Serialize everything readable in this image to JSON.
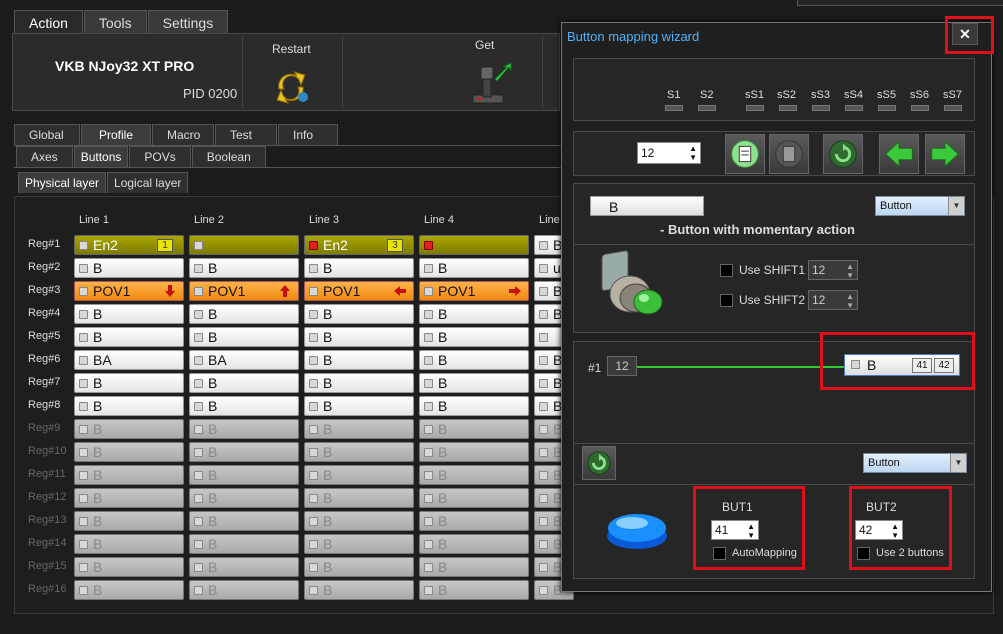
{
  "top_tabs": [
    "Action",
    "Tools",
    "Settings"
  ],
  "device": {
    "name": "VKB NJoy32 XT PRO",
    "pid": "PID 0200"
  },
  "header_buttons": {
    "restart": "Restart",
    "get": "Get"
  },
  "profile_tabs": [
    "Global",
    "Profile",
    "Macro",
    "Test",
    "Info"
  ],
  "sub_tabs": [
    "Axes",
    "Buttons",
    "POVs",
    "Boolean"
  ],
  "layer_tabs": [
    "Physical layer",
    "Logical layer"
  ],
  "columns": [
    "Line 1",
    "Line 2",
    "Line 3",
    "Line 4",
    "Line"
  ],
  "rows": [
    {
      "label": "Reg#1",
      "cells": [
        {
          "text": "En2",
          "num": "1"
        },
        {
          "text": ""
        },
        {
          "text": "En2",
          "num": "3"
        },
        {
          "text": ""
        },
        {
          "text": "B"
        }
      ]
    },
    {
      "label": "Reg#2",
      "cells": [
        {
          "text": "B"
        },
        {
          "text": "B"
        },
        {
          "text": "B"
        },
        {
          "text": "B"
        },
        {
          "text": "u"
        }
      ]
    },
    {
      "label": "Reg#3",
      "cells": [
        {
          "text": "POV1"
        },
        {
          "text": "POV1"
        },
        {
          "text": "POV1"
        },
        {
          "text": "POV1"
        },
        {
          "text": "B"
        }
      ]
    },
    {
      "label": "Reg#4",
      "cells": [
        {
          "text": "B"
        },
        {
          "text": "B"
        },
        {
          "text": "B"
        },
        {
          "text": "B"
        },
        {
          "text": "B"
        }
      ]
    },
    {
      "label": "Reg#5",
      "cells": [
        {
          "text": "B"
        },
        {
          "text": "B"
        },
        {
          "text": "B"
        },
        {
          "text": "B"
        },
        {
          "text": ""
        }
      ]
    },
    {
      "label": "Reg#6",
      "cells": [
        {
          "text": "BA"
        },
        {
          "text": "BA"
        },
        {
          "text": "B"
        },
        {
          "text": "B"
        },
        {
          "text": "B"
        }
      ]
    },
    {
      "label": "Reg#7",
      "cells": [
        {
          "text": "B"
        },
        {
          "text": "B"
        },
        {
          "text": "B"
        },
        {
          "text": "B"
        },
        {
          "text": "B"
        }
      ]
    },
    {
      "label": "Reg#8",
      "cells": [
        {
          "text": "B"
        },
        {
          "text": "B"
        },
        {
          "text": "B"
        },
        {
          "text": "B"
        },
        {
          "text": "B"
        }
      ]
    },
    {
      "label": "Reg#9",
      "cells": [
        {
          "text": "B"
        },
        {
          "text": "B"
        },
        {
          "text": "B"
        },
        {
          "text": "B"
        },
        {
          "text": "B"
        }
      ]
    },
    {
      "label": "Reg#10",
      "cells": [
        {
          "text": "B"
        },
        {
          "text": "B"
        },
        {
          "text": "B"
        },
        {
          "text": "B"
        },
        {
          "text": "B"
        }
      ]
    },
    {
      "label": "Reg#11",
      "cells": [
        {
          "text": "B"
        },
        {
          "text": "B"
        },
        {
          "text": "B"
        },
        {
          "text": "B"
        },
        {
          "text": "B"
        }
      ]
    },
    {
      "label": "Reg#12",
      "cells": [
        {
          "text": "B"
        },
        {
          "text": "B"
        },
        {
          "text": "B"
        },
        {
          "text": "B"
        },
        {
          "text": "B"
        }
      ]
    },
    {
      "label": "Reg#13",
      "cells": [
        {
          "text": "B"
        },
        {
          "text": "B"
        },
        {
          "text": "B"
        },
        {
          "text": "B"
        },
        {
          "text": "B"
        }
      ]
    },
    {
      "label": "Reg#14",
      "cells": [
        {
          "text": "B"
        },
        {
          "text": "B"
        },
        {
          "text": "B"
        },
        {
          "text": "B"
        },
        {
          "text": "B"
        }
      ]
    },
    {
      "label": "Reg#15",
      "cells": [
        {
          "text": "B"
        },
        {
          "text": "B"
        },
        {
          "text": "B"
        },
        {
          "text": "B"
        },
        {
          "text": "B"
        }
      ]
    },
    {
      "label": "Reg#16",
      "cells": [
        {
          "text": "B"
        },
        {
          "text": "B"
        },
        {
          "text": "B"
        },
        {
          "text": "B"
        },
        {
          "text": "B"
        }
      ]
    }
  ],
  "wizard": {
    "title": "Button mapping wizard",
    "close": "✕",
    "shift_labels": [
      "S1",
      "S2",
      "sS1",
      "sS2",
      "sS3",
      "sS4",
      "sS5",
      "sS6",
      "sS7"
    ],
    "button_number": "12",
    "mapping_value": "B",
    "type_select": "Button",
    "description": "- Button with momentary action",
    "use_shift1": "Use SHIFT1",
    "use_shift2": "Use SHIFT2",
    "shift1_value": "12",
    "shift2_value": "12",
    "line_label": "#1",
    "line_value": "12",
    "result_text": "B",
    "result_num1": "41",
    "result_num2": "42",
    "bottom_select": "Button",
    "but1_label": "BUT1",
    "but1_value": "41",
    "automapping": "AutoMapping",
    "but2_label": "BUT2",
    "but2_value": "42",
    "use2buttons": "Use 2 buttons"
  }
}
